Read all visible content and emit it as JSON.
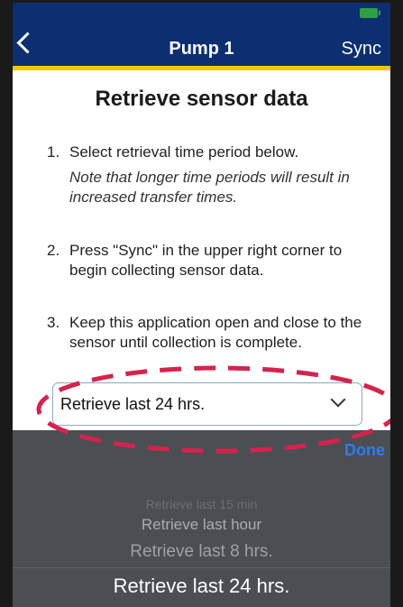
{
  "nav": {
    "title": "Pump 1",
    "action": "Sync"
  },
  "heading": "Retrieve sensor data",
  "steps": [
    {
      "num": "1.",
      "text": "Select retrieval time period below.",
      "note": "Note that longer time periods will result in increased transfer times."
    },
    {
      "num": "2.",
      "text": "Press \"Sync\" in the upper right corner to begin collecting sensor data."
    },
    {
      "num": "3.",
      "text": "Keep this application open and close to the sensor until collection is complete."
    }
  ],
  "selector": {
    "value": "Retrieve last 24 hrs."
  },
  "picker": {
    "done": "Done",
    "options": [
      "Retrieve last 15 min",
      "Retrieve last hour",
      "Retrieve last 8 hrs.",
      "Retrieve last 24 hrs."
    ]
  },
  "colors": {
    "navbar": "#0c2f72",
    "accent": "#f5c400",
    "highlight": "#d4234f",
    "picker_bg": "#4b4e52",
    "done": "#2d7cf3"
  }
}
